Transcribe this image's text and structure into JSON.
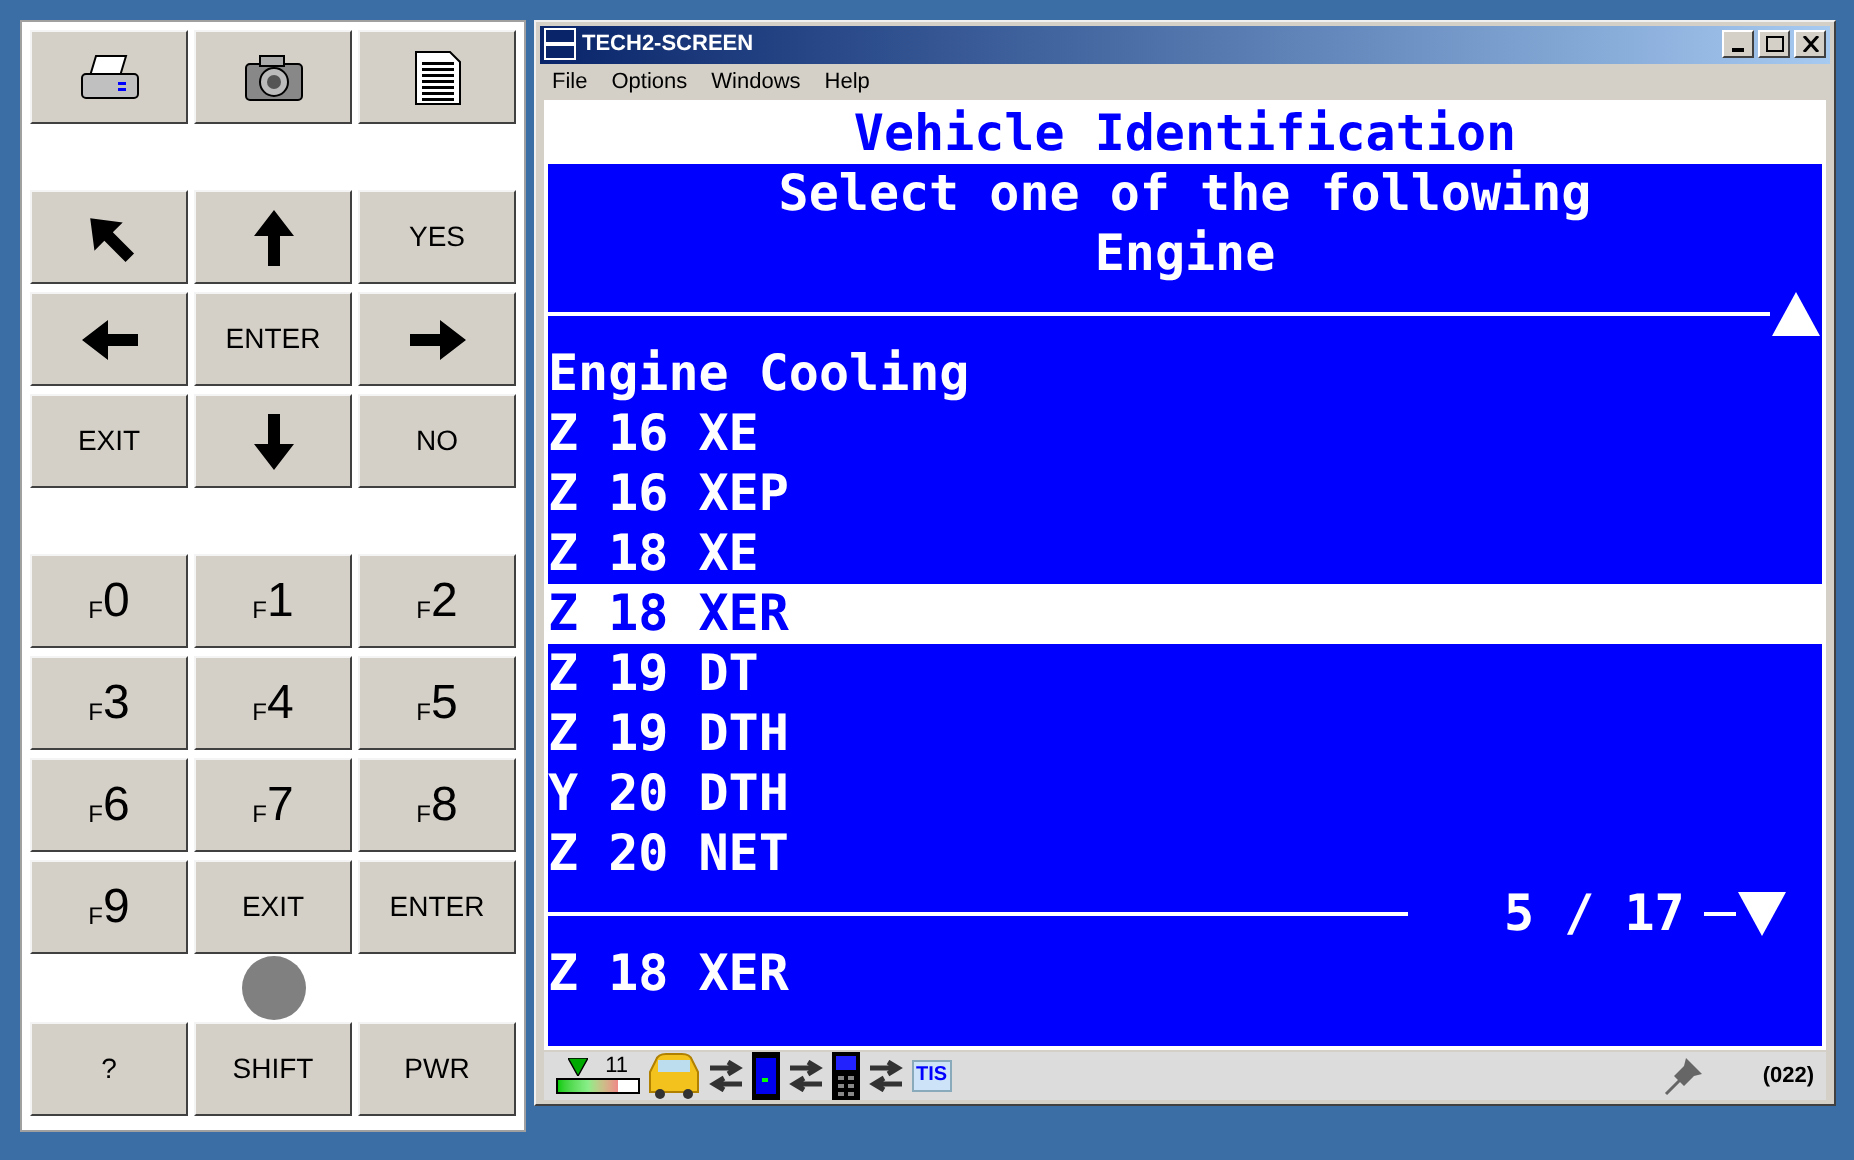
{
  "keypad": {
    "rows": [
      [
        {
          "kind": "printer"
        },
        {
          "kind": "camera"
        },
        {
          "kind": "document"
        }
      ],
      [
        {
          "kind": "gap"
        }
      ],
      [
        {
          "kind": "arrow-upleft"
        },
        {
          "kind": "arrow-up"
        },
        {
          "kind": "text",
          "label": "YES"
        }
      ],
      [
        {
          "kind": "arrow-left"
        },
        {
          "kind": "text",
          "label": "ENTER"
        },
        {
          "kind": "arrow-right"
        }
      ],
      [
        {
          "kind": "text",
          "label": "EXIT"
        },
        {
          "kind": "arrow-down"
        },
        {
          "kind": "text",
          "label": "NO"
        }
      ],
      [
        {
          "kind": "gap"
        }
      ],
      [
        {
          "kind": "fkey",
          "prefix": "F",
          "label": "0"
        },
        {
          "kind": "fkey",
          "prefix": "F",
          "label": "1"
        },
        {
          "kind": "fkey",
          "prefix": "F",
          "label": "2"
        }
      ],
      [
        {
          "kind": "fkey",
          "prefix": "F",
          "label": "3"
        },
        {
          "kind": "fkey",
          "prefix": "F",
          "label": "4"
        },
        {
          "kind": "fkey",
          "prefix": "F",
          "label": "5"
        }
      ],
      [
        {
          "kind": "fkey",
          "prefix": "F",
          "label": "6"
        },
        {
          "kind": "fkey",
          "prefix": "F",
          "label": "7"
        },
        {
          "kind": "fkey",
          "prefix": "F",
          "label": "8"
        }
      ],
      [
        {
          "kind": "fkey",
          "prefix": "F",
          "label": "9"
        },
        {
          "kind": "text",
          "label": "EXIT"
        },
        {
          "kind": "text",
          "label": "ENTER"
        }
      ],
      [
        {
          "kind": "led"
        }
      ],
      [
        {
          "kind": "text",
          "label": "?"
        },
        {
          "kind": "text",
          "label": "SHIFT"
        },
        {
          "kind": "text",
          "label": "PWR"
        }
      ]
    ]
  },
  "window": {
    "title": "TECH2-SCREEN",
    "menu": [
      "File",
      "Options",
      "Windows",
      "Help"
    ]
  },
  "screen": {
    "title": "Vehicle Identification",
    "subtitle": [
      "Select one of the following",
      "Engine"
    ],
    "items": [
      {
        "label": "Engine Cooling",
        "selected": false
      },
      {
        "label": "Z 16 XE",
        "selected": false
      },
      {
        "label": "Z 16 XEP",
        "selected": false
      },
      {
        "label": "Z 18 XE",
        "selected": false
      },
      {
        "label": "Z 18 XER",
        "selected": true
      },
      {
        "label": "Z 19 DT",
        "selected": false
      },
      {
        "label": "Z 19 DTH",
        "selected": false
      },
      {
        "label": "Y 20 DTH",
        "selected": false
      },
      {
        "label": "Z 20 NET",
        "selected": false
      }
    ],
    "position": "5 / 17",
    "footer": "Z 18 XER"
  },
  "status_bar": {
    "signal": "11",
    "level": 0.75,
    "tis": "TIS",
    "code": "(022)"
  }
}
